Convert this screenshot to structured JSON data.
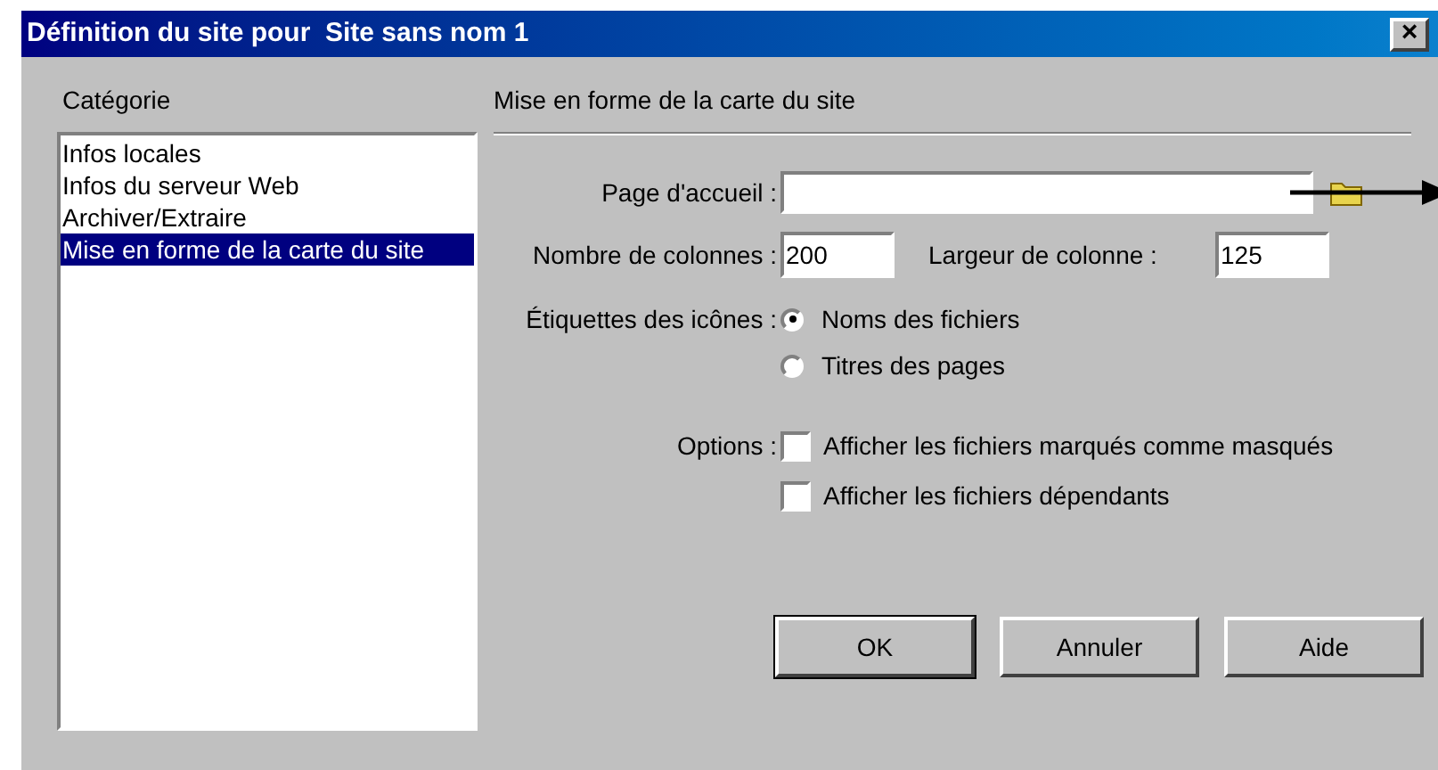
{
  "window": {
    "title": "Définition du site pour  Site sans nom 1",
    "close": "×"
  },
  "category": {
    "heading": "Catégorie",
    "items": [
      {
        "label": "Infos locales",
        "selected": false
      },
      {
        "label": "Infos du serveur Web",
        "selected": false
      },
      {
        "label": "Archiver/Extraire",
        "selected": false
      },
      {
        "label": "Mise en forme de la carte du site",
        "selected": true
      }
    ]
  },
  "panel": {
    "heading": "Mise en forme de la carte du site",
    "home_page": {
      "label": "Page d'accueil :"
    },
    "columns": {
      "label": "Nombre de colonnes :",
      "value": "200"
    },
    "column_width": {
      "label": "Largeur de colonne :",
      "value": "125"
    },
    "icon_labels": {
      "label": "Étiquettes des icônes :",
      "options": [
        {
          "label": "Noms des fichiers",
          "selected": true
        },
        {
          "label": "Titres des pages",
          "selected": false
        }
      ]
    },
    "options": {
      "label": "Options :",
      "items": [
        {
          "label": "Afficher les fichiers marqués comme masqués",
          "checked": false
        },
        {
          "label": "Afficher les fichiers dépendants",
          "checked": false
        }
      ]
    }
  },
  "buttons": [
    {
      "label": "OK",
      "default": true
    },
    {
      "label": "Annuler",
      "default": false
    },
    {
      "label": "Aide",
      "default": false
    }
  ]
}
